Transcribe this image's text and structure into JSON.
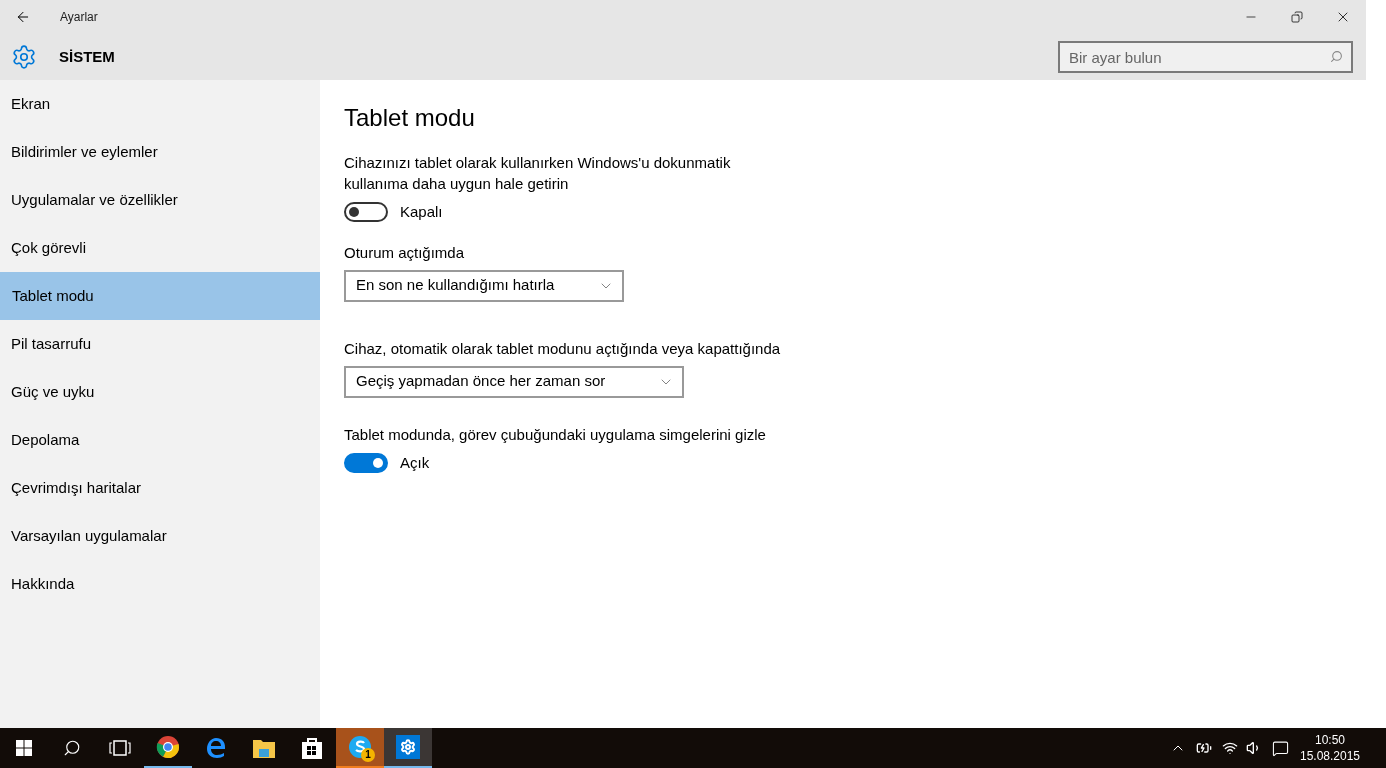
{
  "window": {
    "title": "Ayarlar"
  },
  "header": {
    "title": "SİSTEM",
    "search": {
      "placeholder": "Bir ayar bulun"
    }
  },
  "sidebar": {
    "items": [
      {
        "label": "Ekran",
        "selected": false
      },
      {
        "label": "Bildirimler ve eylemler",
        "selected": false
      },
      {
        "label": "Uygulamalar ve özellikler",
        "selected": false
      },
      {
        "label": "Çok görevli",
        "selected": false
      },
      {
        "label": "Tablet modu",
        "selected": true
      },
      {
        "label": "Pil tasarrufu",
        "selected": false
      },
      {
        "label": "Güç ve uyku",
        "selected": false
      },
      {
        "label": "Depolama",
        "selected": false
      },
      {
        "label": "Çevrimdışı haritalar",
        "selected": false
      },
      {
        "label": "Varsayılan uygulamalar",
        "selected": false
      },
      {
        "label": "Hakkında",
        "selected": false
      }
    ]
  },
  "content": {
    "title": "Tablet modu",
    "settings": [
      {
        "kind": "toggle",
        "label": "Cihazınızı tablet olarak kullanırken Windows'u dokunmatik kullanıma daha uygun hale getirin",
        "on": false,
        "state_text": "Kapalı"
      },
      {
        "kind": "dropdown",
        "label": "Oturum açtığımda",
        "value": "En son ne kullandığımı hatırla"
      },
      {
        "kind": "dropdown",
        "label": "Cihaz, otomatik olarak tablet modunu açtığında veya kapattığında",
        "value": "Geçiş yapmadan önce her zaman sor"
      },
      {
        "kind": "toggle",
        "label": "Tablet modunda, görev çubuğundaki uygulama simgelerini gizle",
        "on": true,
        "state_text": "Açık"
      }
    ]
  },
  "taskbar": {
    "apps": [
      {
        "kind": "chrome",
        "running": true,
        "selected": false
      },
      {
        "kind": "edge",
        "running": false,
        "selected": false
      },
      {
        "kind": "folder",
        "running": false,
        "selected": false
      },
      {
        "kind": "store",
        "running": false,
        "selected": false
      },
      {
        "kind": "skype",
        "running": true,
        "selected": false,
        "flashing": true,
        "badge": "1"
      },
      {
        "kind": "settings",
        "running": true,
        "selected": true
      }
    ],
    "time": "10:50",
    "date": "15.08.2015"
  }
}
